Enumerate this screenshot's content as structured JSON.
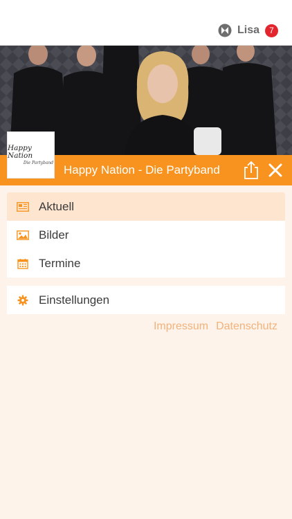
{
  "header": {
    "username": "Lisa",
    "notification_count": "7"
  },
  "band": {
    "logo_text": "Happy Nation",
    "logo_subtext": "Die Partyband",
    "title": "Happy Nation - Die Partyband"
  },
  "menu": {
    "items": [
      {
        "label": "Aktuell",
        "icon": "news-icon",
        "active": true
      },
      {
        "label": "Bilder",
        "icon": "image-icon",
        "active": false
      },
      {
        "label": "Termine",
        "icon": "calendar-icon",
        "active": false
      }
    ],
    "settings_label": "Einstellungen"
  },
  "footer_links": {
    "impressum": "Impressum",
    "datenschutz": "Datenschutz"
  },
  "colors": {
    "accent": "#f7931e",
    "active_row": "#fde5d0",
    "background": "#fdf3ea",
    "badge": "#e3262e",
    "link": "#f2b27a"
  }
}
